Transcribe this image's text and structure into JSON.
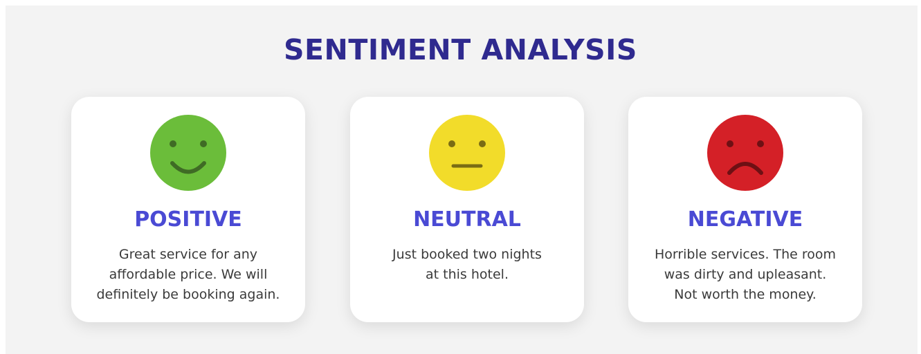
{
  "title": "SENTIMENT ANALYSIS",
  "cards": [
    {
      "icon": "smiling-face-icon",
      "color": "#6bbd3a",
      "label": "POSITIVE",
      "lines": [
        "Great service for any",
        "affordable price. We will",
        "definitely be booking again."
      ]
    },
    {
      "icon": "neutral-face-icon",
      "color": "#f2dc2a",
      "label": "NEUTRAL",
      "lines": [
        "Just booked two nights",
        "at this hotel."
      ]
    },
    {
      "icon": "frowning-face-icon",
      "color": "#d42027",
      "label": "NEGATIVE",
      "lines": [
        "Horrible services. The room",
        "was dirty and upleasant.",
        "Not worth the money."
      ]
    }
  ],
  "colors": {
    "title": "#2f2a8f",
    "label": "#4a4ad4",
    "background": "#f3f3f3"
  }
}
